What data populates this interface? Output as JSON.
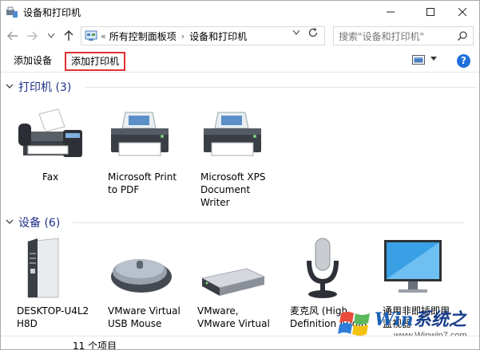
{
  "window": {
    "title": "设备和打印机"
  },
  "nav": {
    "crumb_root": "所有控制面板项",
    "crumb_current": "设备和打印机",
    "search_placeholder": "搜索\"设备和打印机\""
  },
  "toolbar": {
    "add_device": "添加设备",
    "add_printer": "添加打印机",
    "help": "?"
  },
  "printers": {
    "header": "打印机 (3)",
    "items": [
      {
        "lines": [
          "Fax"
        ]
      },
      {
        "lines": [
          "Microsoft Print",
          "to PDF"
        ]
      },
      {
        "lines": [
          "Microsoft XPS",
          "Document",
          "Writer"
        ]
      }
    ]
  },
  "devices": {
    "header": "设备 (6)",
    "items": [
      {
        "lines": [
          "DESKTOP-U4L2",
          "H8D"
        ]
      },
      {
        "lines": [
          "VMware Virtual",
          "USB Mouse"
        ]
      },
      {
        "lines": [
          "VMware,",
          "VMware Virtual"
        ]
      },
      {
        "lines": [
          "麦克风 (High",
          "Definition Audio"
        ]
      },
      {
        "lines": [
          "通用非即插即用",
          "监视器"
        ]
      }
    ]
  },
  "status": {
    "count": "11 个项目"
  },
  "watermark": {
    "brand": "Win",
    "suffix": "系统之家",
    "url": "www.Winwin7.com"
  },
  "colors": {
    "accent": "#1e3287",
    "highlight": "#e03030",
    "help": "#1e6fd9"
  }
}
